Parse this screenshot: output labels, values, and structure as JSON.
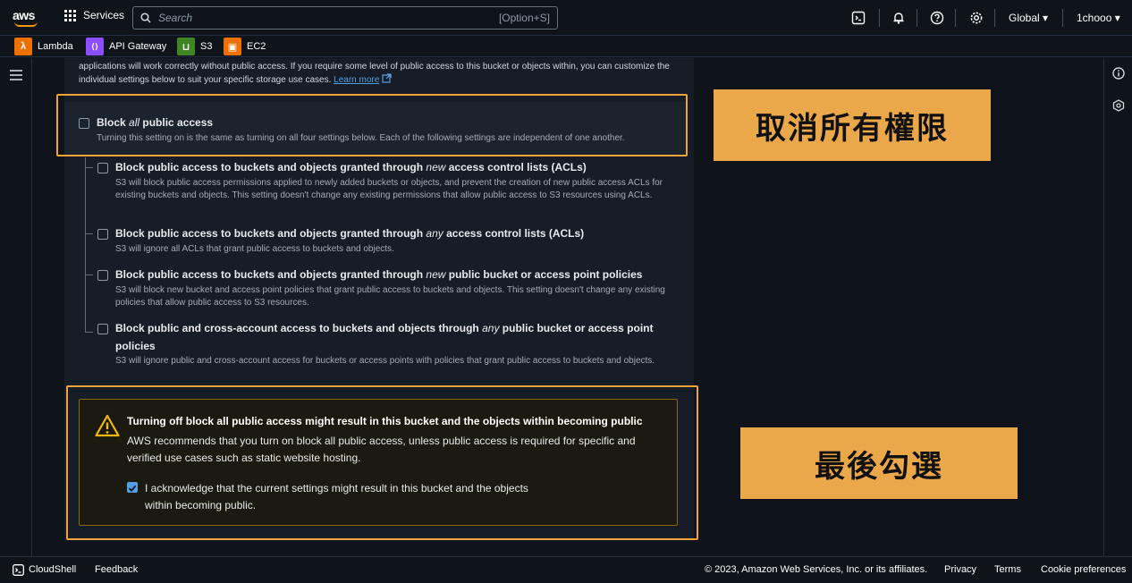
{
  "topbar": {
    "logo_text": "aws",
    "services_label": "Services",
    "search_placeholder": "Search",
    "search_shortcut": "[Option+S]",
    "region": "Global ▾",
    "user": "1chooo ▾"
  },
  "favorites": [
    {
      "label": "Lambda",
      "color": "#ed7100",
      "glyph": "λ"
    },
    {
      "label": "API Gateway",
      "color": "#8c4fff",
      "glyph": "⟨⟩"
    },
    {
      "label": "S3",
      "color": "#3f8624",
      "glyph": "⊔"
    },
    {
      "label": "EC2",
      "color": "#ed7100",
      "glyph": "▣"
    }
  ],
  "intro": {
    "text": "applications will work correctly without public access. If you require some level of public access to this bucket or objects within, you can customize the individual settings below to suit your specific storage use cases.",
    "link": "Learn more"
  },
  "block_all": {
    "title_pre": "Block ",
    "title_em": "all",
    "title_post": " public access",
    "desc": "Turning this setting on is the same as turning on all four settings below. Each of the following settings are independent of one another."
  },
  "options": [
    {
      "title_pre": "Block public access to buckets and objects granted through ",
      "title_em": "new",
      "title_post": " access control lists (ACLs)",
      "desc": "S3 will block public access permissions applied to newly added buckets or objects, and prevent the creation of new public access ACLs for existing buckets and objects. This setting doesn't change any existing permissions that allow public access to S3 resources using ACLs."
    },
    {
      "title_pre": "Block public access to buckets and objects granted through ",
      "title_em": "any",
      "title_post": " access control lists (ACLs)",
      "desc": "S3 will ignore all ACLs that grant public access to buckets and objects."
    },
    {
      "title_pre": "Block public access to buckets and objects granted through ",
      "title_em": "new",
      "title_post": " public bucket or access point policies",
      "desc": "S3 will block new bucket and access point policies that grant public access to buckets and objects. This setting doesn't change any existing policies that allow public access to S3 resources."
    },
    {
      "title_pre": "Block public and cross-account access to buckets and objects through ",
      "title_em": "any",
      "title_post": " public bucket or access point",
      "title_line2": "policies",
      "desc": "S3 will ignore public and cross-account access for buckets or access points with policies that grant public access to buckets and objects."
    }
  ],
  "warning": {
    "title": "Turning off block all public access might result in this bucket and the objects within becoming public",
    "body": "AWS recommends that you turn on block all public access, unless public access is required for specific and verified use cases such as static website hosting.",
    "ack": "I acknowledge that the current settings might result in this bucket and the objects within becoming public.",
    "ack_checked": true
  },
  "callouts": {
    "top": "取消所有權限",
    "bottom": "最後勾選",
    "color": "#eba84a"
  },
  "footer": {
    "cloudshell": "CloudShell",
    "feedback": "Feedback",
    "copyright": "© 2023, Amazon Web Services, Inc. or its affiliates.",
    "privacy": "Privacy",
    "terms": "Terms",
    "cookies": "Cookie preferences"
  }
}
